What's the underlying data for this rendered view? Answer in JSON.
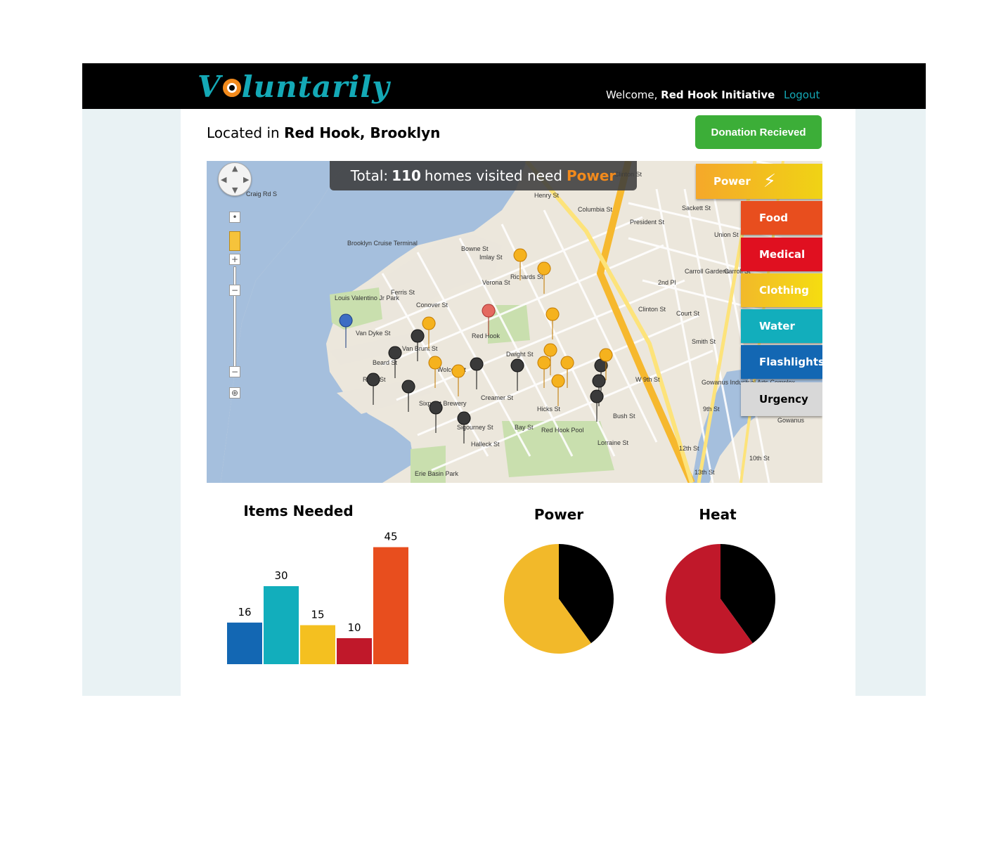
{
  "app": {
    "brand": "Voluntarily",
    "welcome_prefix": "Welcome,",
    "user": "Red Hook Initiative",
    "logout": "Logout"
  },
  "location": {
    "prefix": "Located in",
    "place": "Red Hook, Brooklyn"
  },
  "donation_button": "Donation Recieved",
  "map": {
    "banner": {
      "prefix": "Total:",
      "count": "110",
      "middle": "homes visited need",
      "need": "Power"
    },
    "categories": [
      {
        "label": "Power",
        "color": "#f5a82a"
      },
      {
        "label": "Food",
        "color": "#e84e1e"
      },
      {
        "label": "Medical",
        "color": "#e01020"
      },
      {
        "label": "Clothing",
        "color": "#f4c020"
      },
      {
        "label": "Water",
        "color": "#12aebc"
      },
      {
        "label": "Flashlights",
        "color": "#1367b3"
      },
      {
        "label": "Urgency",
        "color": "#d8d8d8"
      }
    ],
    "place_labels": [
      "Craig Rd S",
      "Brooklyn Cruise Terminal",
      "Louis Valentino Jr Park",
      "Red Hook",
      "Carroll Gardens",
      "Gowanus Industrial Arts Complex",
      "Red Hook Pool",
      "Erie Basin Park",
      "Sixpoint Brewery",
      "President St",
      "Union St",
      "Sackett St",
      "2nd Pl",
      "Court St",
      "Smith St",
      "W 9th St",
      "9th St",
      "Bush St",
      "Lorraine St",
      "Creamer St",
      "Bay St",
      "Van Dyke St",
      "Beard St",
      "Reed St",
      "Ferris St",
      "Conover St",
      "Imlay St",
      "Bowne St",
      "Verona St",
      "Richards St",
      "Columbia St",
      "Clinton St",
      "Henry St",
      "Dwight St",
      "Hicks St",
      "Halleck St",
      "Sigourney St",
      "Van Brunt St",
      "Wolcott St",
      "Gowanus",
      "10th St",
      "12th St",
      "13th St",
      "Clinton St",
      "Carroll St"
    ]
  },
  "chart_data": [
    {
      "type": "bar",
      "title": "Items Needed",
      "values": [
        16,
        30,
        15,
        10,
        45
      ],
      "colors": [
        "#1367b3",
        "#12aebc",
        "#f4c020",
        "#c0182a",
        "#e84e1e"
      ],
      "ylim": [
        0,
        50
      ]
    },
    {
      "type": "pie",
      "title": "Power",
      "values": [
        40,
        60
      ],
      "colors": [
        "#000000",
        "#f2b92a"
      ]
    },
    {
      "type": "pie",
      "title": "Heat",
      "values": [
        40,
        60
      ],
      "colors": [
        "#000000",
        "#c0182a"
      ]
    }
  ]
}
